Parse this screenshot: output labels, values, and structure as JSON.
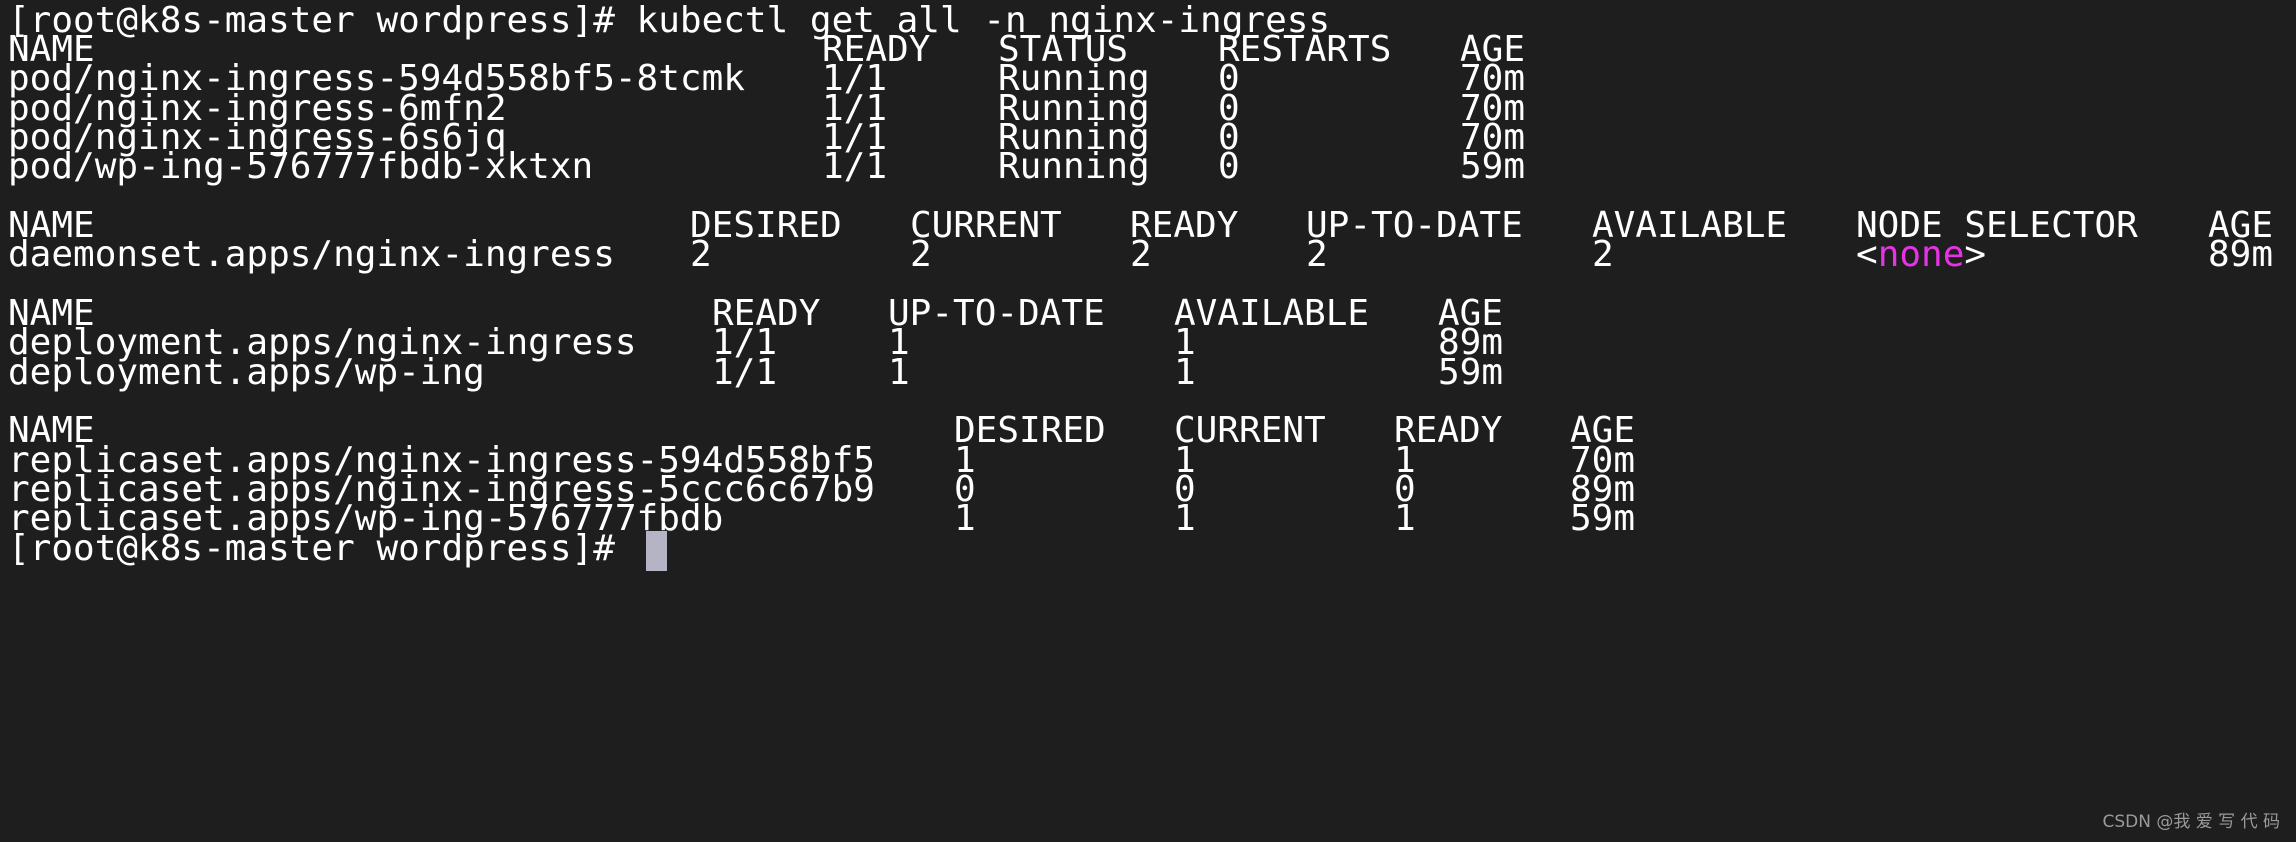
{
  "prompt_command": "[root@k8s-master wordpress]# kubectl get all -n nginx-ingress",
  "pods": {
    "headers": [
      "NAME",
      "READY",
      "STATUS",
      "RESTARTS",
      "AGE"
    ],
    "rows": [
      [
        "pod/nginx-ingress-594d558bf5-8tcmk",
        "1/1",
        "Running",
        "0",
        "70m"
      ],
      [
        "pod/nginx-ingress-6mfn2",
        "1/1",
        "Running",
        "0",
        "70m"
      ],
      [
        "pod/nginx-ingress-6s6jq",
        "1/1",
        "Running",
        "0",
        "70m"
      ],
      [
        "pod/wp-ing-576777fbdb-xktxn",
        "1/1",
        "Running",
        "0",
        "59m"
      ]
    ]
  },
  "daemonsets": {
    "headers": [
      "NAME",
      "DESIRED",
      "CURRENT",
      "READY",
      "UP-TO-DATE",
      "AVAILABLE",
      "NODE SELECTOR",
      "AGE"
    ],
    "rows": [
      [
        "daemonset.apps/nginx-ingress",
        "2",
        "2",
        "2",
        "2",
        "2",
        "none",
        "89m"
      ]
    ],
    "selector_open": "<",
    "selector_close": ">"
  },
  "deployments": {
    "headers": [
      "NAME",
      "READY",
      "UP-TO-DATE",
      "AVAILABLE",
      "AGE"
    ],
    "rows": [
      [
        "deployment.apps/nginx-ingress",
        "1/1",
        "1",
        "1",
        "89m"
      ],
      [
        "deployment.apps/wp-ing",
        "1/1",
        "1",
        "1",
        "59m"
      ]
    ]
  },
  "replicasets": {
    "headers": [
      "NAME",
      "DESIRED",
      "CURRENT",
      "READY",
      "AGE"
    ],
    "rows": [
      [
        "replicaset.apps/nginx-ingress-594d558bf5",
        "1",
        "1",
        "1",
        "70m"
      ],
      [
        "replicaset.apps/nginx-ingress-5ccc6c67b9",
        "0",
        "0",
        "0",
        "89m"
      ],
      [
        "replicaset.apps/wp-ing-576777fbdb",
        "1",
        "1",
        "1",
        "59m"
      ]
    ]
  },
  "final_prompt": "[root@k8s-master wordpress]#",
  "watermark": "CSDN @我 爱 写 代 码",
  "colors": {
    "background": "#1e1e1e",
    "foreground": "#ffffff",
    "highlight": "#e533e5",
    "cursor": "#b4b4c4"
  }
}
